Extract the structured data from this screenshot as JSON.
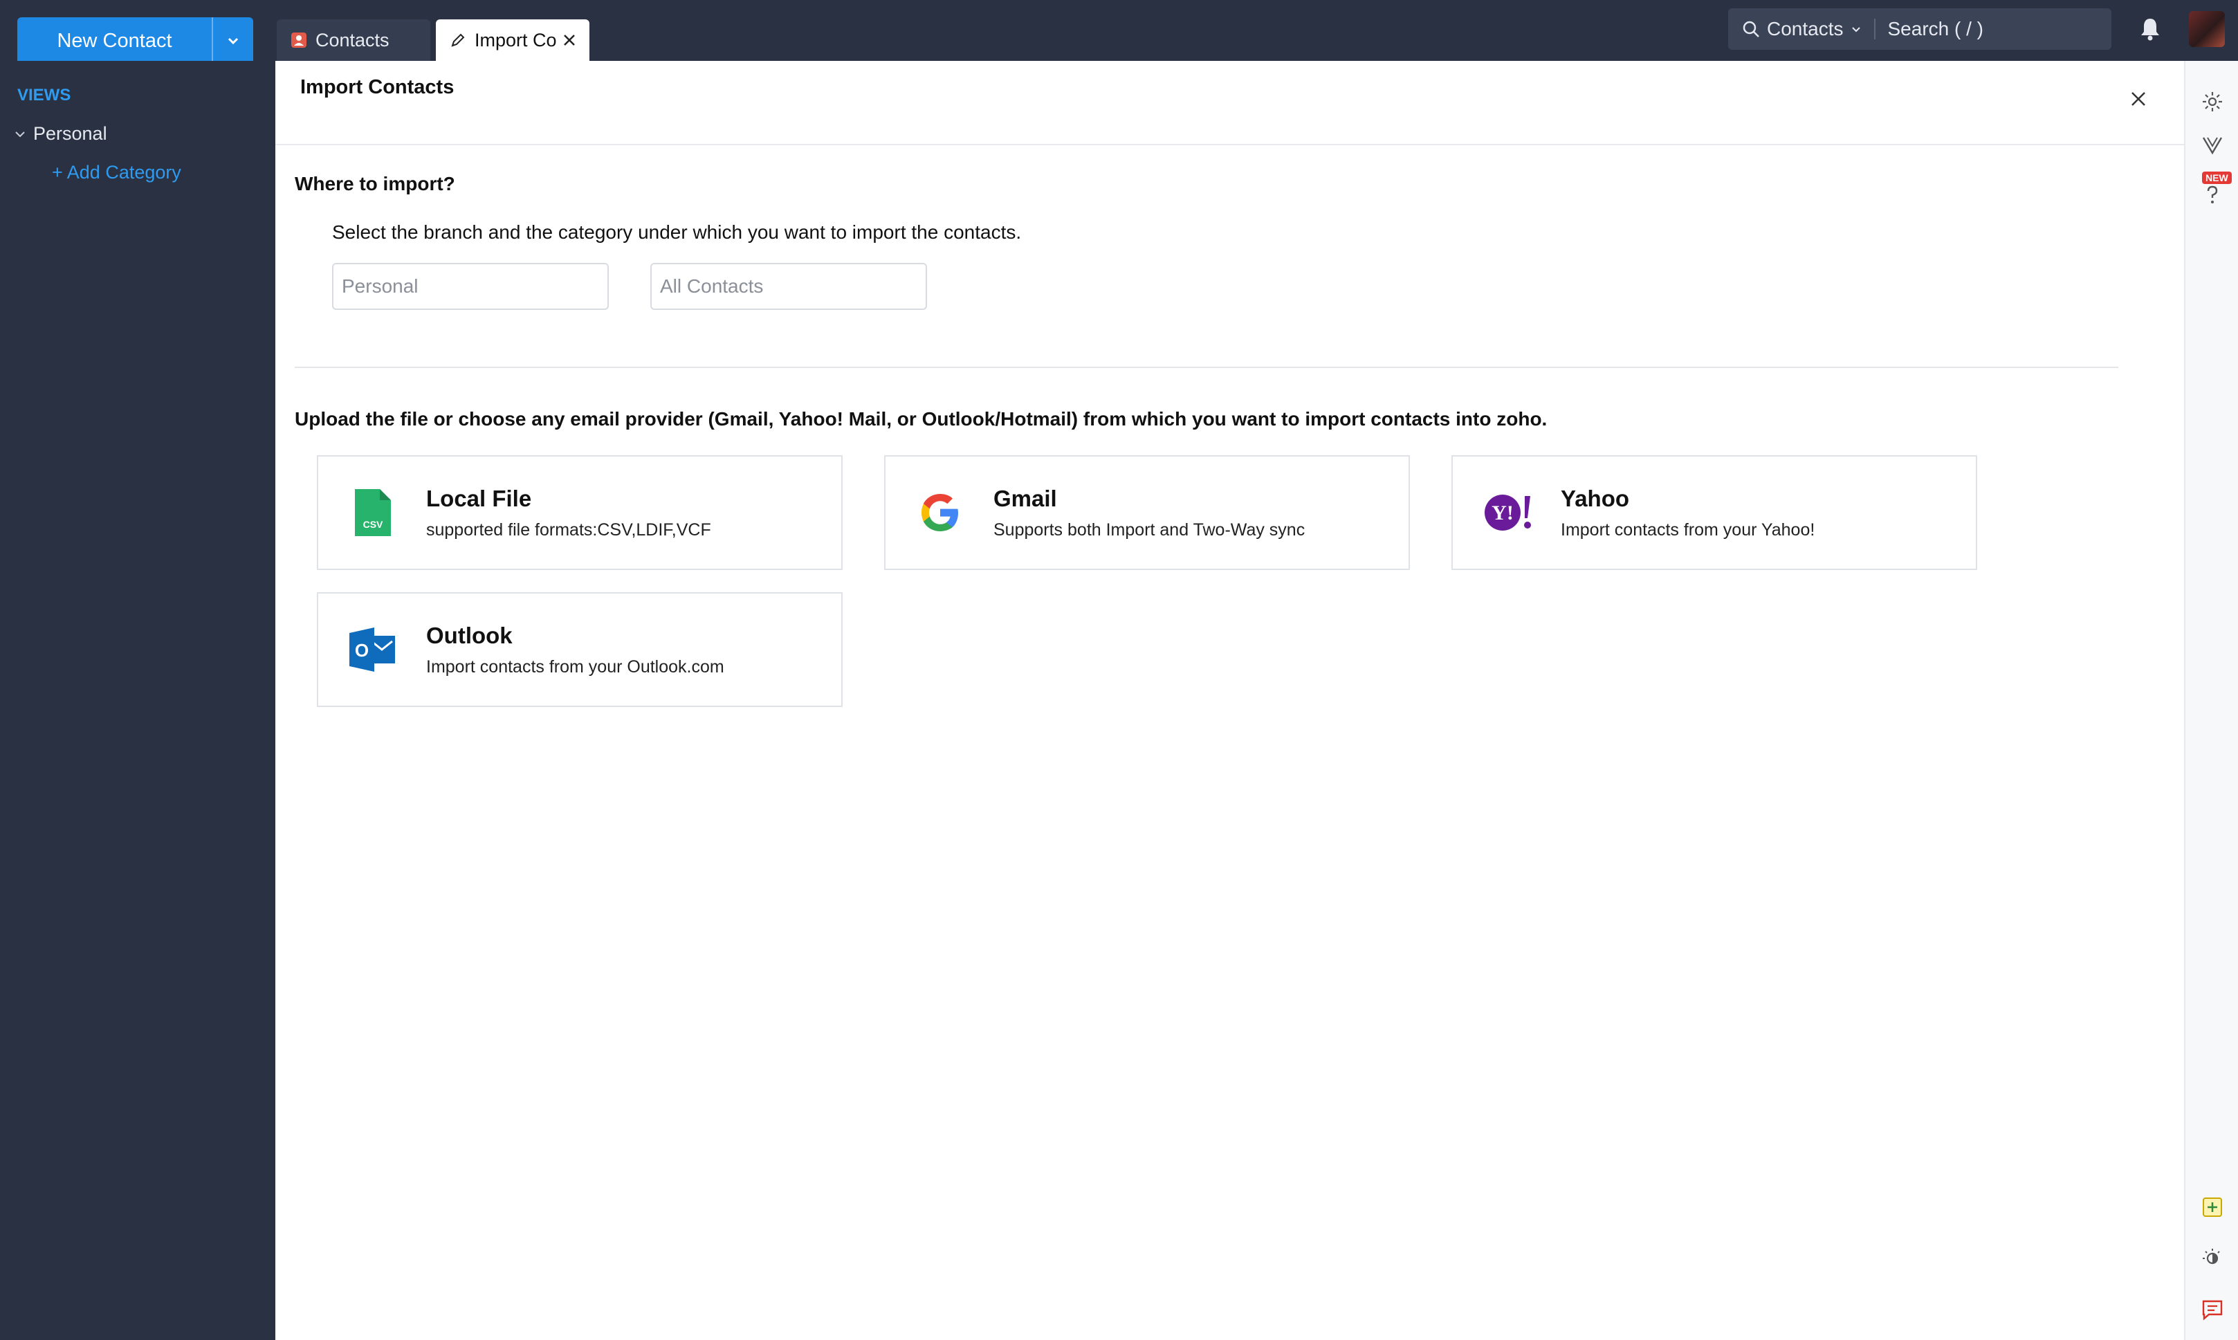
{
  "header": {
    "new_contact_label": "New Contact",
    "tabs": [
      {
        "label": "Contacts"
      },
      {
        "label": "Import Contacts"
      }
    ],
    "search": {
      "scope": "Contacts",
      "placeholder": "Search ( / )"
    }
  },
  "sidebar": {
    "views_label": "VIEWS",
    "personal_label": "Personal",
    "add_category_label": "+ Add Category"
  },
  "rail": {
    "new_badge": "NEW"
  },
  "panel": {
    "title": "Import Contacts",
    "where_label": "Where to import?",
    "where_desc": "Select the branch and the category under which you want to import the contacts.",
    "branch_value": "Personal",
    "category_value": "All Contacts",
    "upload_desc": "Upload the file or choose any email provider (Gmail, Yahoo! Mail, or Outlook/Hotmail) from which you want to import contacts into zoho.",
    "cards": [
      {
        "title": "Local File",
        "subtitle": "supported file formats:CSV,LDIF,VCF",
        "icon_text": "CSV"
      },
      {
        "title": "Gmail",
        "subtitle": "Supports both Import and Two-Way sync"
      },
      {
        "title": "Yahoo",
        "subtitle": "Import contacts from your Yahoo!",
        "icon_text": "Y!"
      },
      {
        "title": "Outlook",
        "subtitle": "Import contacts from your Outlook.com",
        "icon_text": "O"
      }
    ]
  },
  "colors": {
    "brand_blue": "#1e88e5",
    "sidebar_bg": "#2a3142",
    "link_blue": "#2f9bf0",
    "csv_green": "#27b36b",
    "yahoo_purple": "#6a1b9a",
    "outlook_blue": "#0f6cbd"
  }
}
